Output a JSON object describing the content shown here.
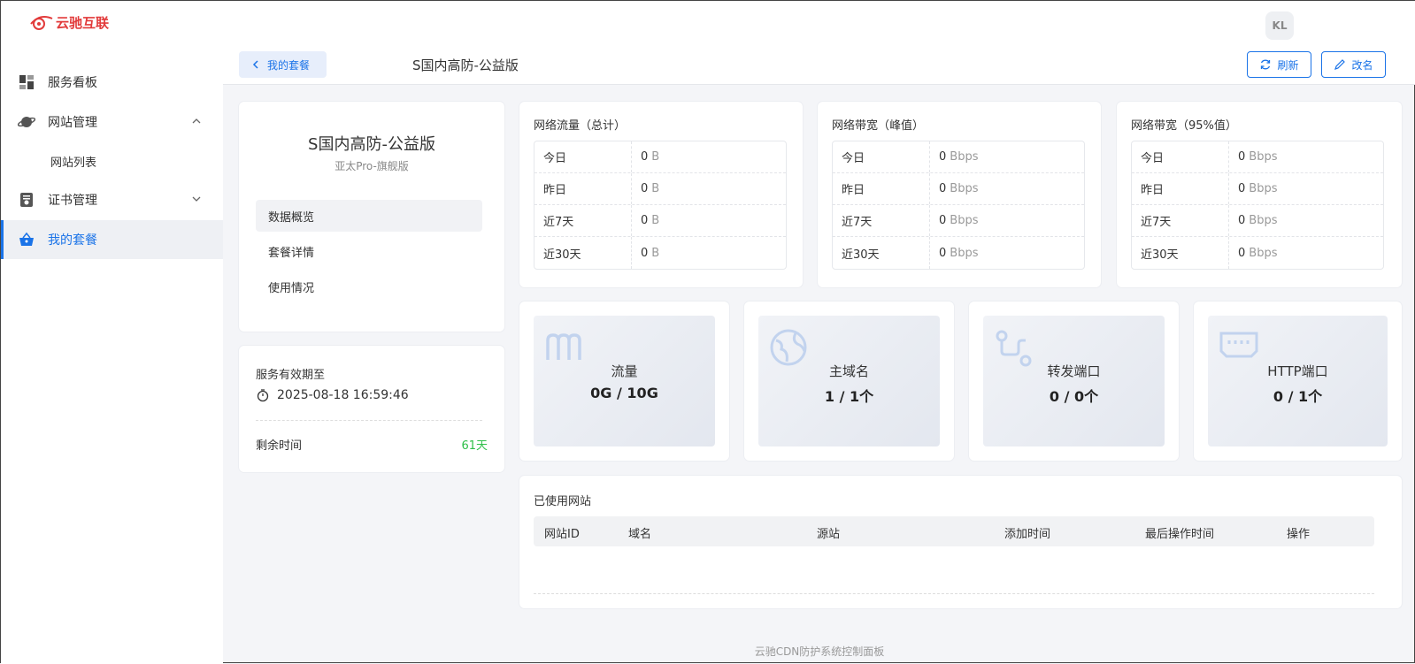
{
  "app": {
    "logo_text": "云驰互联",
    "avatar": "KL",
    "footer": "云驰CDN防护系统控制面板"
  },
  "sidebar": {
    "items": [
      {
        "label": "服务看板",
        "icon": "dashboard-icon"
      },
      {
        "label": "网站管理",
        "icon": "planet-icon",
        "expanded": true,
        "children": [
          "网站列表"
        ]
      },
      {
        "label": "证书管理",
        "icon": "certificate-icon",
        "expanded": false
      },
      {
        "label": "我的套餐",
        "icon": "basket-icon",
        "active": true
      }
    ]
  },
  "header": {
    "back_label": "我的套餐",
    "title": "S国内高防-公益版",
    "refresh_label": "刷新",
    "rename_label": "改名"
  },
  "plan": {
    "name": "S国内高防-公益版",
    "subtitle": "亚太Pro-旗舰版",
    "tabs": [
      "数据概览",
      "套餐详情",
      "使用情况"
    ],
    "active_tab": "数据概览"
  },
  "service": {
    "expire_label": "服务有效期至",
    "expire_date": "2025-08-18 16:59:46",
    "remain_label": "剩余时间",
    "remain_value": "61天"
  },
  "stats": [
    {
      "title": "网络流量（总计）",
      "rows": [
        {
          "k": "今日",
          "v": "0",
          "u": "B"
        },
        {
          "k": "昨日",
          "v": "0",
          "u": "B"
        },
        {
          "k": "近7天",
          "v": "0",
          "u": "B"
        },
        {
          "k": "近30天",
          "v": "0",
          "u": "B"
        }
      ]
    },
    {
      "title": "网络带宽（峰值）",
      "rows": [
        {
          "k": "今日",
          "v": "0",
          "u": "Bbps"
        },
        {
          "k": "昨日",
          "v": "0",
          "u": "Bbps"
        },
        {
          "k": "近7天",
          "v": "0",
          "u": "Bbps"
        },
        {
          "k": "近30天",
          "v": "0",
          "u": "Bbps"
        }
      ]
    },
    {
      "title": "网络带宽（95%值）",
      "rows": [
        {
          "k": "今日",
          "v": "0",
          "u": "Bbps"
        },
        {
          "k": "昨日",
          "v": "0",
          "u": "Bbps"
        },
        {
          "k": "近7天",
          "v": "0",
          "u": "Bbps"
        },
        {
          "k": "近30天",
          "v": "0",
          "u": "Bbps"
        }
      ]
    }
  ],
  "resources": [
    {
      "label": "流量",
      "value": "0G / 10G",
      "icon": "traffic-icon"
    },
    {
      "label": "主域名",
      "value": "1 / 1个",
      "icon": "globe-icon"
    },
    {
      "label": "转发端口",
      "value": "0 / 0个",
      "icon": "route-icon"
    },
    {
      "label": "HTTP端口",
      "value": "0 / 1个",
      "icon": "port-icon"
    }
  ],
  "used_sites": {
    "title": "已使用网站",
    "columns": [
      "网站ID",
      "域名",
      "源站",
      "添加时间",
      "最后操作时间",
      "操作"
    ]
  },
  "colors": {
    "accent": "#1a73e8",
    "success": "#2fbf4a",
    "brand": "#e23b3b"
  }
}
